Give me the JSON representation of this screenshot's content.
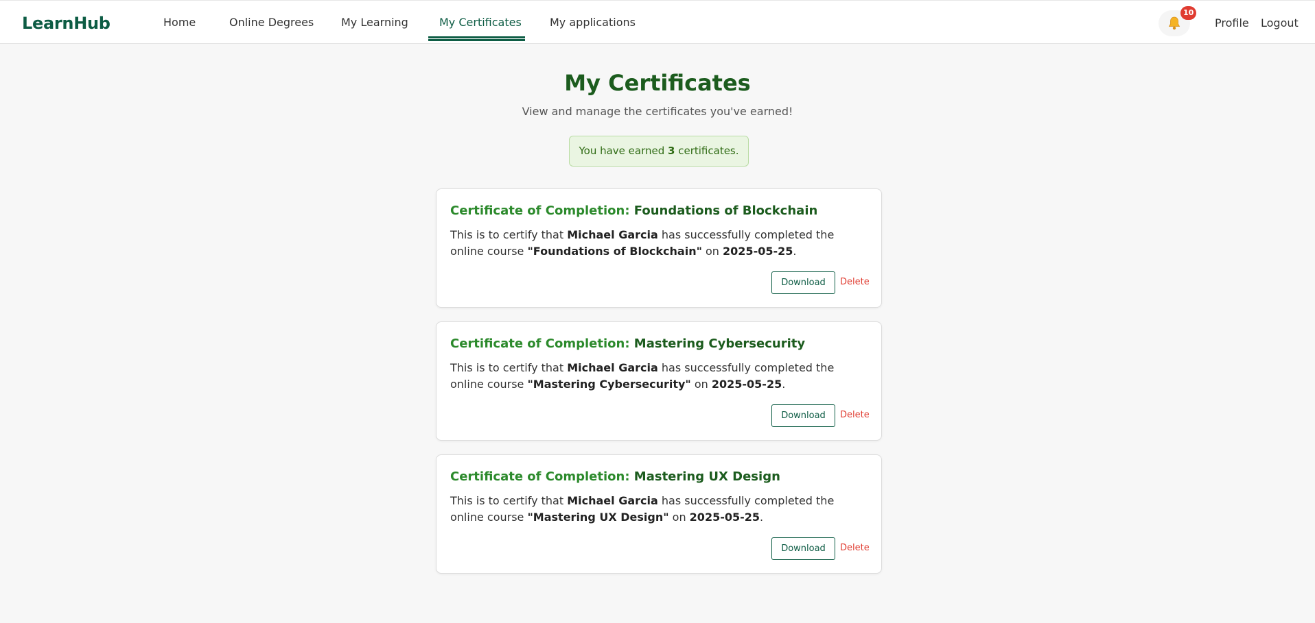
{
  "header": {
    "logo": "LearnHub",
    "nav": [
      {
        "label": "Home"
      },
      {
        "label": "Online Degrees"
      },
      {
        "label": "My Learning"
      },
      {
        "label": "My Certificates",
        "active": true
      },
      {
        "label": "My applications"
      }
    ],
    "notifications": {
      "icon": "bell-icon",
      "count": "10"
    },
    "profile_label": "Profile",
    "logout_label": "Logout"
  },
  "page": {
    "title": "My Certificates",
    "subtitle": "View and manage the certificates you've earned!",
    "summary_prefix": "You have earned ",
    "summary_count": "3",
    "summary_suffix": " certificates."
  },
  "certificates": [
    {
      "title_prefix": "Certificate of Completion: ",
      "course": "Foundations of Blockchain",
      "text_1": "This is to certify that ",
      "name": "Michael Garcia",
      "text_2": " has successfully completed the online course ",
      "course_quoted": "\"Foundations of Blockchain\"",
      "text_3": " on ",
      "date": "2025-05-25",
      "text_4": ".",
      "download_label": "Download",
      "delete_label": "Delete"
    },
    {
      "title_prefix": "Certificate of Completion: ",
      "course": "Mastering Cybersecurity",
      "text_1": "This is to certify that ",
      "name": "Michael Garcia",
      "text_2": " has successfully completed the online course ",
      "course_quoted": "\"Mastering Cybersecurity\"",
      "text_3": " on ",
      "date": "2025-05-25",
      "text_4": ".",
      "download_label": "Download",
      "delete_label": "Delete"
    },
    {
      "title_prefix": "Certificate of Completion: ",
      "course": "Mastering UX Design",
      "text_1": "This is to certify that ",
      "name": "Michael Garcia",
      "text_2": " has successfully completed the online course ",
      "course_quoted": "\"Mastering UX Design\"",
      "text_3": " on ",
      "date": "2025-05-25",
      "text_4": ".",
      "download_label": "Download",
      "delete_label": "Delete"
    }
  ],
  "colors": {
    "brand": "#0d5c44",
    "title_green": "#1c5c1e",
    "cert_title_green": "#2c8a2c",
    "delete_red": "#e03c31",
    "summary_bg": "#eaf5e2"
  }
}
